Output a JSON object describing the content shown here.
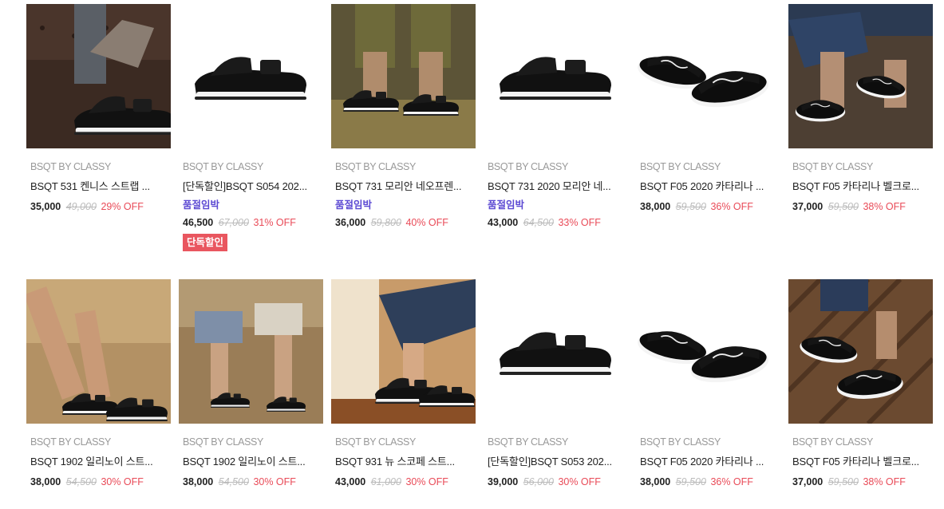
{
  "products": [
    {
      "brand": "BSQT BY CLASSY",
      "name": "BSQT 531 켄니스 스트랩 ...",
      "soldout": "",
      "price": "35,000",
      "orig": "49,000",
      "off": "29% OFF",
      "badge": "",
      "photo": "lifestyle-dark"
    },
    {
      "brand": "BSQT BY CLASSY",
      "name": "[단독할인]BSQT S054 202...",
      "soldout": "품절임박",
      "price": "46,500",
      "orig": "67,000",
      "off": "31% OFF",
      "badge": "단독할인",
      "photo": "product"
    },
    {
      "brand": "BSQT BY CLASSY",
      "name": "BSQT 731 모리안 네오프렌...",
      "soldout": "품절임박",
      "price": "36,000",
      "orig": "59,800",
      "off": "40% OFF",
      "badge": "",
      "photo": "lifestyle-olive"
    },
    {
      "brand": "BSQT BY CLASSY",
      "name": "BSQT 731 2020 모리안 네...",
      "soldout": "품절임박",
      "price": "43,000",
      "orig": "64,500",
      "off": "33% OFF",
      "badge": "",
      "photo": "product"
    },
    {
      "brand": "BSQT BY CLASSY",
      "name": "BSQT F05 2020 카타리나 ...",
      "soldout": "",
      "price": "38,000",
      "orig": "59,500",
      "off": "36% OFF",
      "badge": "",
      "photo": "product-slide"
    },
    {
      "brand": "BSQT BY CLASSY",
      "name": "BSQT F05 카타리나 벨크로...",
      "soldout": "",
      "price": "37,000",
      "orig": "59,500",
      "off": "38% OFF",
      "badge": "",
      "photo": "lifestyle-denim"
    },
    {
      "brand": "BSQT BY CLASSY",
      "name": "BSQT 1902 일리노이 스트...",
      "soldout": "",
      "price": "38,000",
      "orig": "54,500",
      "off": "30% OFF",
      "badge": "",
      "photo": "lifestyle-sofa"
    },
    {
      "brand": "BSQT BY CLASSY",
      "name": "BSQT 1902 일리노이 스트...",
      "soldout": "",
      "price": "38,000",
      "orig": "54,500",
      "off": "30% OFF",
      "badge": "",
      "photo": "lifestyle-couple"
    },
    {
      "brand": "BSQT BY CLASSY",
      "name": "BSQT 931 뉴 스코페 스트...",
      "soldout": "",
      "price": "43,000",
      "orig": "61,000",
      "off": "30% OFF",
      "badge": "",
      "photo": "lifestyle-warm"
    },
    {
      "brand": "BSQT BY CLASSY",
      "name": "[단독할인]BSQT S053 202...",
      "soldout": "",
      "price": "39,000",
      "orig": "56,000",
      "off": "30% OFF",
      "badge": "",
      "photo": "product"
    },
    {
      "brand": "BSQT BY CLASSY",
      "name": "BSQT F05 2020 카타리나 ...",
      "soldout": "",
      "price": "38,000",
      "orig": "59,500",
      "off": "36% OFF",
      "badge": "",
      "photo": "product-slide"
    },
    {
      "brand": "BSQT BY CLASSY",
      "name": "BSQT F05 카타리나 벨크로...",
      "soldout": "",
      "price": "37,000",
      "orig": "59,500",
      "off": "38% OFF",
      "badge": "",
      "photo": "lifestyle-wood"
    }
  ],
  "colors": {
    "sale": "#e94b58",
    "soldout": "#5d4bd3",
    "badge": "#e9565f",
    "brand": "#999999",
    "orig": "#bbbbbb"
  }
}
